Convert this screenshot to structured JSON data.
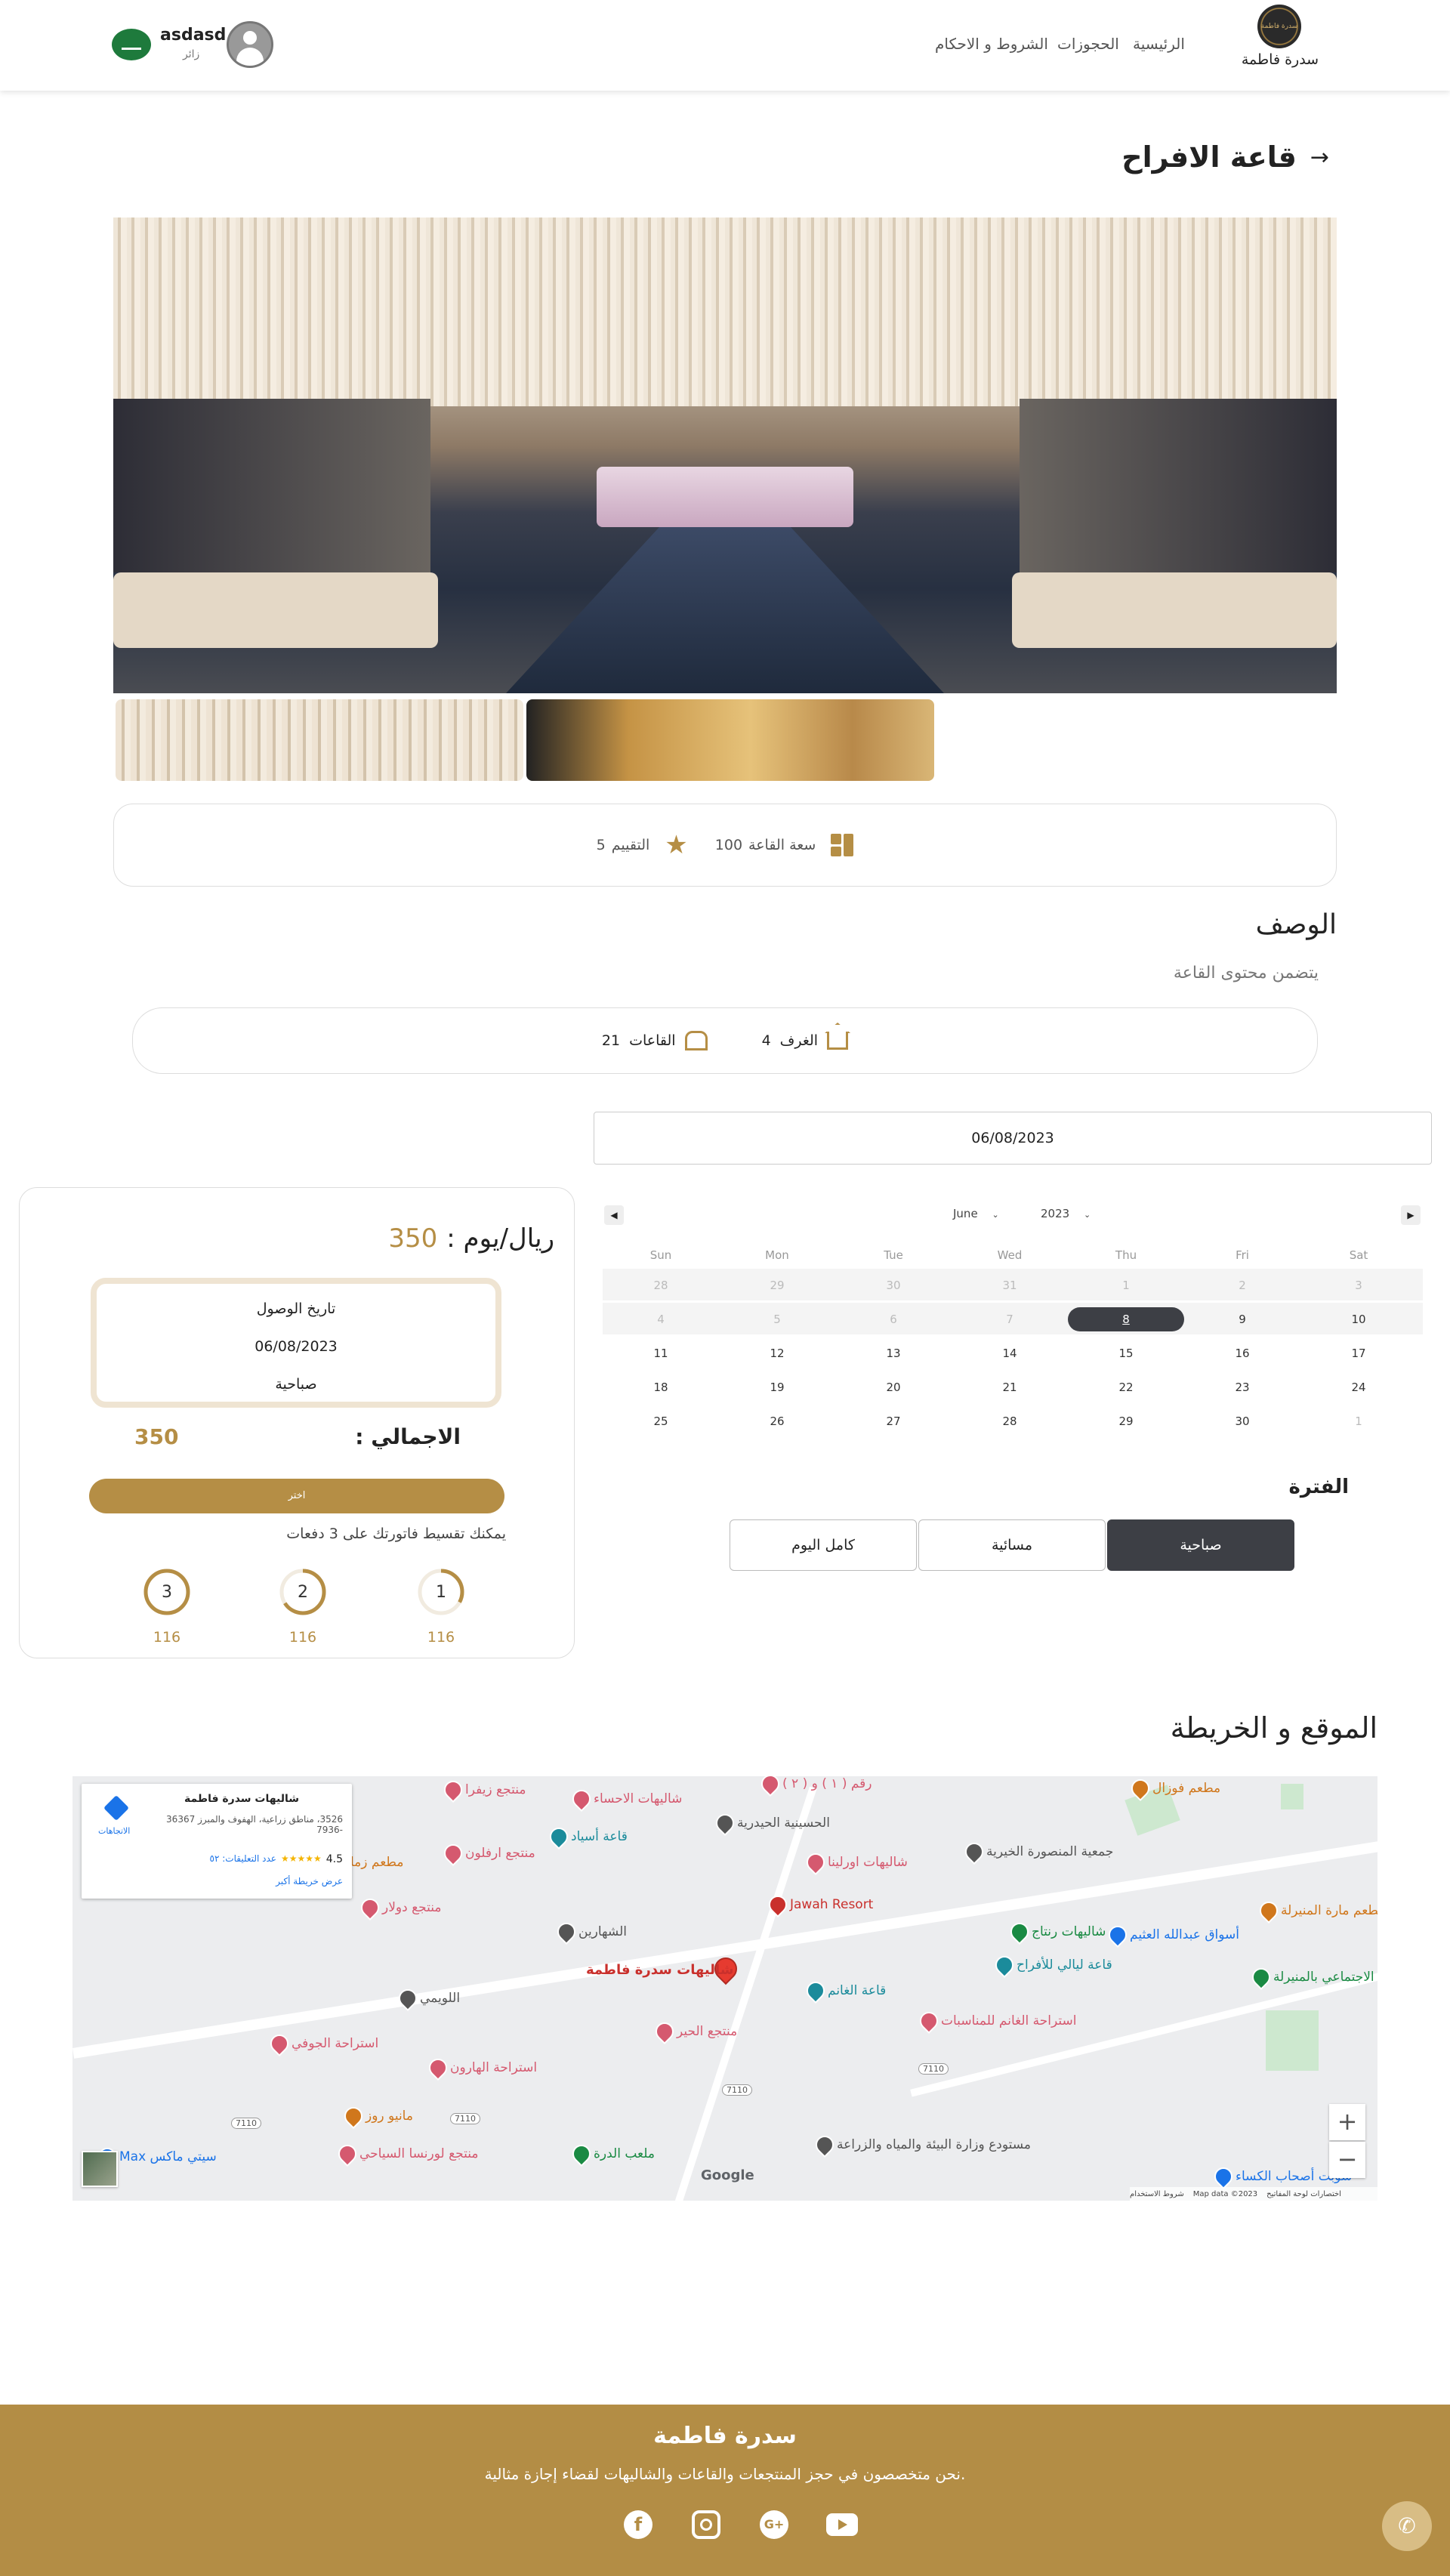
{
  "header": {
    "brand_name": "سدرة فاطمة",
    "logo_text": "سدرة فاطمة",
    "nav": [
      "الرئيسية",
      "الحجوزات",
      "الشروط و الاحكام"
    ],
    "user_name": "asdasd",
    "user_role": "زائر"
  },
  "page": {
    "title": "قاعة الافراح"
  },
  "stats": {
    "capacity_label": "سعة القاعة",
    "capacity_value": "100",
    "rating_label": "التقييم",
    "rating_value": "5"
  },
  "description": {
    "heading": "الوصف",
    "text": "يتضمن محتوى القاعة",
    "rooms_label": "الغرف",
    "rooms_value": "4",
    "halls_label": "القاعات",
    "halls_value": "21"
  },
  "booking": {
    "date_input_value": "06/08/2023",
    "price_value": "350",
    "price_unit": "ريال/يوم :",
    "arrival_label": "تاريخ الوصول",
    "arrival_date": "06/08/2023",
    "arrival_period": "صباحية",
    "total_label": "الاجمالي :",
    "total_value": "350",
    "choose_button": "اختر",
    "installment_text": "يمكنك تقسيط فاتورتك على 3 دفعات",
    "installments": [
      {
        "step": "1",
        "amount": "116",
        "progress": 0.33
      },
      {
        "step": "2",
        "amount": "116",
        "progress": 0.66
      },
      {
        "step": "3",
        "amount": "116",
        "progress": 1.0
      }
    ]
  },
  "calendar": {
    "month": "June",
    "year": "2023",
    "weekdays": [
      "Sun",
      "Mon",
      "Tue",
      "Wed",
      "Thu",
      "Fri",
      "Sat"
    ],
    "weeks": [
      [
        "28",
        "29",
        "30",
        "31",
        "1",
        "2",
        "3"
      ],
      [
        "4",
        "5",
        "6",
        "7",
        "8",
        "9",
        "10"
      ],
      [
        "11",
        "12",
        "13",
        "14",
        "15",
        "16",
        "17"
      ],
      [
        "18",
        "19",
        "20",
        "21",
        "22",
        "23",
        "24"
      ],
      [
        "25",
        "26",
        "27",
        "28",
        "29",
        "30",
        "1"
      ]
    ],
    "selected_day": "8"
  },
  "period": {
    "heading": "الفترة",
    "options": [
      "صباحية",
      "مسائية",
      "كامل اليوم"
    ],
    "selected": "صباحية"
  },
  "map_section": {
    "heading": "الموقع و الخريطة",
    "card_title": "شاليهات سدرة فاطمة",
    "card_address": "3526، مناطق زراعية، الهفوف والمبرز 36367 -7936",
    "card_rating": "4.5",
    "card_reviews": "عدد التعليقات: ٥٢",
    "card_larger_map": "عرض خريطة أكبر",
    "card_directions": "الاتجاهات",
    "main_pin_label": "شاليهات سدرة فاطمة",
    "labels": [
      "منتجع زيفرا",
      "شاليهات الاحساء",
      "الحسينية الحيدرية",
      "جمعية المنصورة الخيرية",
      "مطعم فوزال",
      "منتجع ارفلون",
      "قاعة أسياد",
      "شاليهات اورلينا",
      "مطعم زماء",
      "منتجع دولار",
      "Jawah Resort",
      "الشهارين",
      "شاليهات رنتاج",
      "أسواق عبدالله العثيم",
      "قاعة ليالي للأفراح",
      "مطعم مارة المنيرلة",
      "اللويمي",
      "منتجع الحير",
      "قاعة الغانم",
      "استراحة الغانم للمناسبات",
      "مقر مركز النشاط الاجتماعي بالمنيرلة",
      "استراحة الجوفي",
      "استراحة الهارون",
      "مانيو روز",
      "ملعب الدرة",
      "مستودع وزارة البيئة والمياه والزراعة",
      "سيتي ماكس Max",
      "منتجع لورنسا السياحي",
      "سوبت أصحاب الكساء",
      "رقم ( ١ ) و ( ٢ )"
    ],
    "road_labels": [
      "7110",
      "7110",
      "7110",
      "7110"
    ],
    "attribution": "Map data ©2023",
    "terms": "شروط الاستخدام",
    "report": "اختصارات لوحة المفاتيح",
    "google": "Google"
  },
  "footer": {
    "brand": "سدرة فاطمة",
    "tagline": ".نحن متخصصون في حجز المنتجعات والقاعات والشاليهات لقضاء إجازة مثالية",
    "socials": [
      "facebook-icon",
      "instagram-icon",
      "google-plus-icon",
      "youtube-icon"
    ]
  },
  "colors": {
    "accent": "#b58e45",
    "dark": "#3d3f45",
    "footer": "#b38d45"
  }
}
